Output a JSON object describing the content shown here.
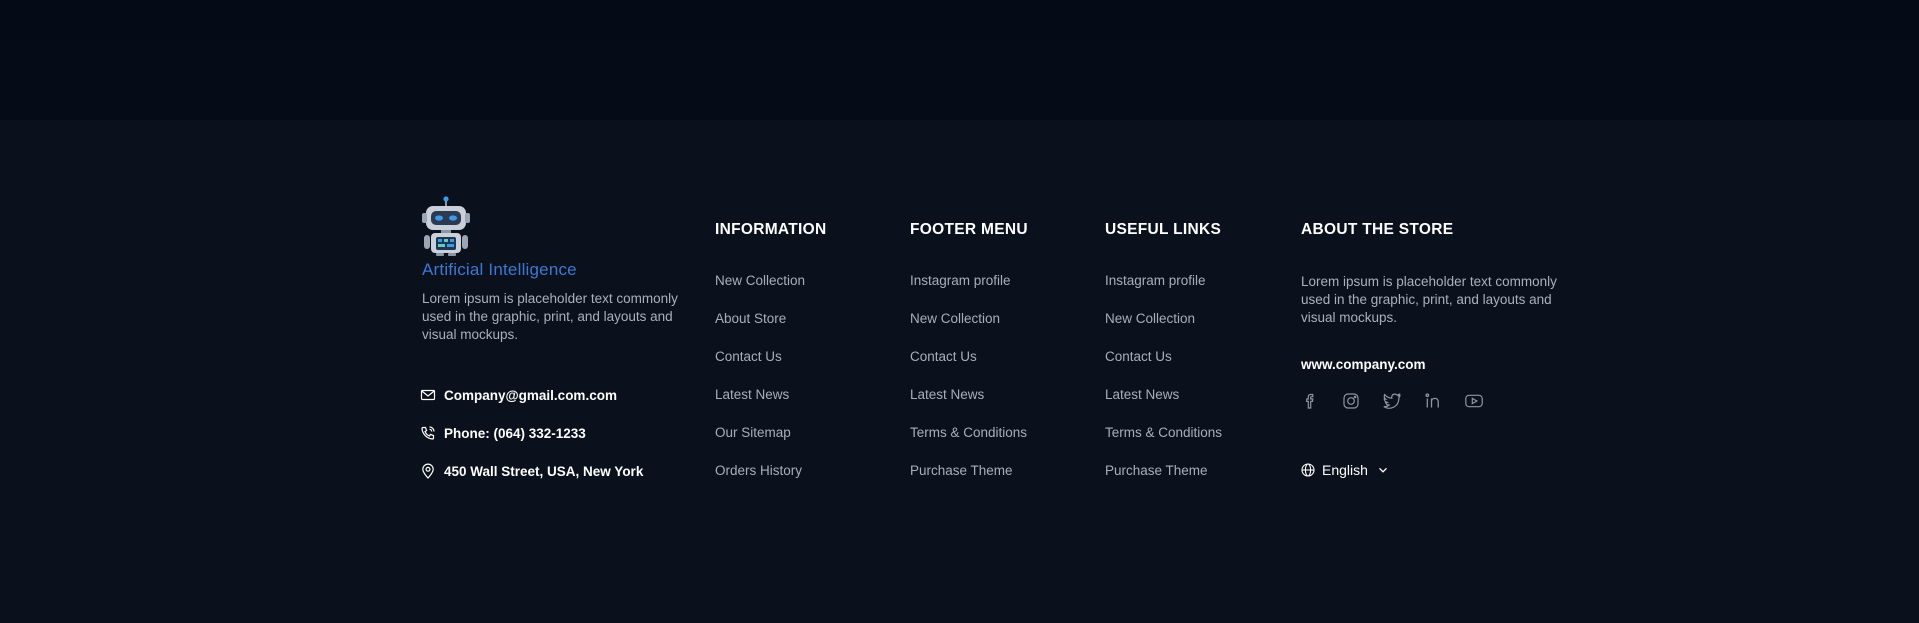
{
  "brand": {
    "name": "Artificial Intelligence",
    "description": "Lorem ipsum is placeholder text commonly used in the graphic, print, and layouts and visual mockups.",
    "logo_icon": "robot-icon"
  },
  "contact": {
    "email": "Company@gmail.com.com",
    "phone": "Phone: (064) 332-1233",
    "address": "450 Wall Street, USA, New York"
  },
  "columns": [
    {
      "title": "INFORMATION",
      "items": [
        "New Collection",
        "About Store",
        "Contact Us",
        "Latest News",
        "Our Sitemap",
        "Orders History"
      ]
    },
    {
      "title": "FOOTER MENU",
      "items": [
        "Instagram profile",
        "New Collection",
        "Contact Us",
        "Latest News",
        "Terms & Conditions",
        "Purchase Theme"
      ]
    },
    {
      "title": "USEFUL LINKS",
      "items": [
        "Instagram profile",
        "New Collection",
        "Contact Us",
        "Latest News",
        "Terms & Conditions",
        "Purchase Theme"
      ]
    }
  ],
  "about": {
    "title": "ABOUT THE STORE",
    "description": "Lorem ipsum is placeholder text commonly used in the graphic, print, and layouts and visual mockups.",
    "website": "www.company.com",
    "socials": [
      "facebook-icon",
      "instagram-icon",
      "twitter-icon",
      "linkedin-icon",
      "youtube-icon"
    ],
    "language": "English"
  },
  "colors": {
    "background": "#0a111c",
    "accent": "#3a78d4",
    "muted_text": "#a9afba"
  }
}
